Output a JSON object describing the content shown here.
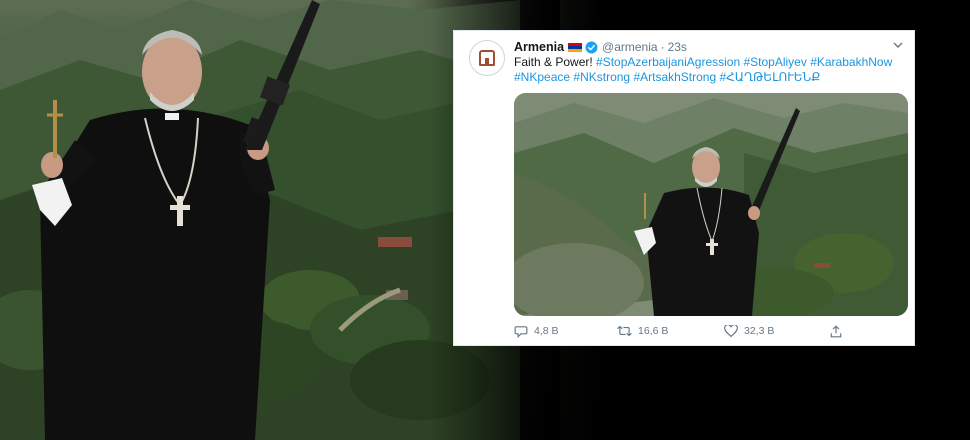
{
  "tweet": {
    "display_name": "Armenia",
    "handle": "@armenia",
    "separator": "·",
    "time": "23s",
    "text_plain": "Faith & Power!",
    "hashtags_line1": [
      "#StopAzerbaijaniAgression",
      "#StopAliyev",
      "#KarabakhNow"
    ],
    "hashtags_line2": [
      "#NKpeace",
      "#NKstrong",
      "#ArtsakhStrong",
      "#ՀԱՂԹԵԼՈՒԵՆՔ"
    ],
    "actions": {
      "reply_count": "4,8 B",
      "retweet_count": "16,6 B",
      "like_count": "32,3 B"
    },
    "icons": {
      "avatar": "logo-icon",
      "flag": "armenia-flag-icon",
      "verified": "verified-badge-icon",
      "more": "chevron-down-icon",
      "reply": "reply-icon",
      "retweet": "retweet-icon",
      "like": "heart-icon",
      "share": "share-icon"
    }
  },
  "colors": {
    "link": "#1b95e0",
    "verified": "#1da1f2",
    "flag_red": "#d90012",
    "flag_blue": "#0033a0",
    "flag_orange": "#f2a800",
    "muted": "#657786"
  }
}
